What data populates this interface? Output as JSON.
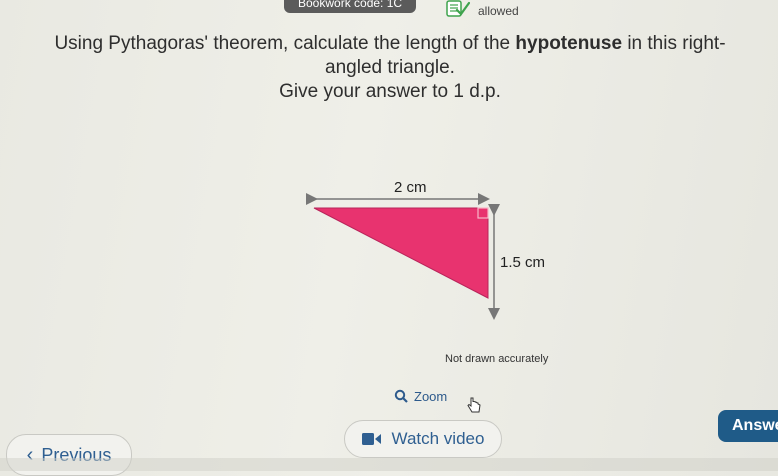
{
  "topbar": {
    "bookwork_label": "Bookwork code: 1C",
    "calculator_status": "allowed"
  },
  "question": {
    "line1_prefix": "Using Pythagoras' theorem, calculate the length of the ",
    "line1_bold": "hypotenuse",
    "line1_suffix": " in this right-",
    "line2": "angled triangle.",
    "line3": "Give your answer to 1 d.p."
  },
  "diagram": {
    "top_label": "2 cm",
    "side_label": "1.5 cm",
    "note": "Not drawn accurately",
    "fill_color": "#e8336f",
    "arrow_color": "#777777"
  },
  "controls": {
    "zoom_label": "Zoom",
    "watch_video_label": "Watch video",
    "previous_label": "Previous",
    "answer_label": "Answe"
  }
}
